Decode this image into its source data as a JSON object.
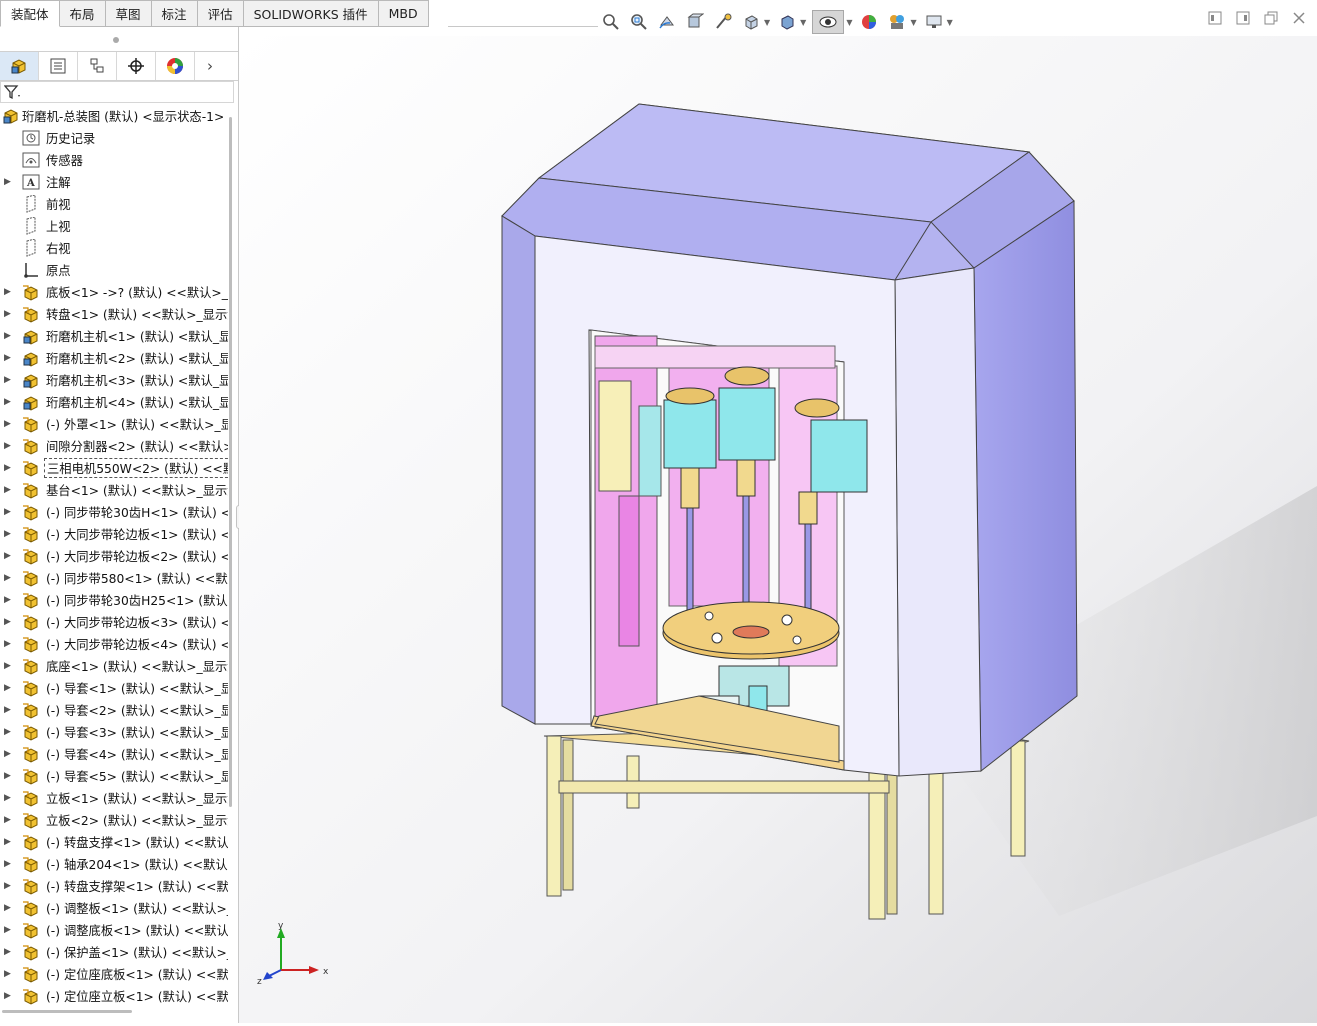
{
  "tabs": [
    "装配体",
    "布局",
    "草图",
    "标注",
    "评估",
    "SOLIDWORKS 插件",
    "MBD"
  ],
  "view_toolbar": {
    "icons": [
      "zoom-to-fit-icon",
      "zoom-area-icon",
      "previous-view-icon",
      "section-view-icon",
      "dynamic-annotation-icon",
      "view-orientation-icon",
      "display-style-icon",
      "hide-show-icon",
      "edit-appearance-icon",
      "apply-scene-icon",
      "view-settings-icon"
    ]
  },
  "feature_tree": {
    "root": "珩磨机-总装图 (默认) <显示状态-1>",
    "items": [
      {
        "label": "历史记录",
        "icon": "history-icon",
        "arrow": false
      },
      {
        "label": "传感器",
        "icon": "sensor-icon",
        "arrow": false
      },
      {
        "label": "注解",
        "icon": "annotation-icon",
        "arrow": true
      },
      {
        "label": "前视",
        "icon": "plane-icon",
        "arrow": false
      },
      {
        "label": "上视",
        "icon": "plane-icon",
        "arrow": false
      },
      {
        "label": "右视",
        "icon": "plane-icon",
        "arrow": false
      },
      {
        "label": "原点",
        "icon": "origin-icon",
        "arrow": false
      },
      {
        "label": "底板<1> ->? (默认) <<默认>_显",
        "icon": "part-icon",
        "arrow": true
      },
      {
        "label": "转盘<1> (默认) <<默认>_显示划",
        "icon": "part-icon",
        "arrow": true
      },
      {
        "label": "珩磨机主机<1> (默认) <默认_显",
        "icon": "assembly-icon",
        "arrow": true
      },
      {
        "label": "珩磨机主机<2> (默认) <默认_显",
        "icon": "assembly-icon",
        "arrow": true
      },
      {
        "label": "珩磨机主机<3> (默认) <默认_显",
        "icon": "assembly-icon",
        "arrow": true
      },
      {
        "label": "珩磨机主机<4> (默认) <默认_显",
        "icon": "assembly-icon",
        "arrow": true
      },
      {
        "label": "(-) 外罩<1> (默认) <<默认>_显",
        "icon": "part-icon",
        "arrow": true
      },
      {
        "label": "间隙分割器<2> (默认) <<默认>",
        "icon": "part-icon",
        "arrow": true
      },
      {
        "label": "三相电机550W<2> (默认) <<默",
        "icon": "part-icon",
        "arrow": true,
        "selected": true
      },
      {
        "label": "基台<1> (默认) <<默认>_显示划",
        "icon": "part-icon",
        "arrow": true
      },
      {
        "label": "(-) 同步带轮30齿H<1> (默认) <",
        "icon": "part-icon",
        "arrow": true
      },
      {
        "label": "(-) 大同步带轮边板<1> (默认) <",
        "icon": "part-icon",
        "arrow": true
      },
      {
        "label": "(-) 大同步带轮边板<2> (默认) <",
        "icon": "part-icon",
        "arrow": true
      },
      {
        "label": "(-) 同步带580<1> (默认) <<默认",
        "icon": "part-icon",
        "arrow": true
      },
      {
        "label": "(-) 同步带轮30齿H25<1> (默认)",
        "icon": "part-icon",
        "arrow": true
      },
      {
        "label": "(-) 大同步带轮边板<3> (默认) <",
        "icon": "part-icon",
        "arrow": true
      },
      {
        "label": "(-) 大同步带轮边板<4> (默认) <",
        "icon": "part-icon",
        "arrow": true
      },
      {
        "label": "底座<1> (默认) <<默认>_显示划",
        "icon": "part-icon",
        "arrow": true
      },
      {
        "label": "(-) 导套<1> (默认) <<默认>_显",
        "icon": "part-icon",
        "arrow": true
      },
      {
        "label": "(-) 导套<2> (默认) <<默认>_显",
        "icon": "part-icon",
        "arrow": true
      },
      {
        "label": "(-) 导套<3> (默认) <<默认>_显",
        "icon": "part-icon",
        "arrow": true
      },
      {
        "label": "(-) 导套<4> (默认) <<默认>_显",
        "icon": "part-icon",
        "arrow": true
      },
      {
        "label": "(-) 导套<5> (默认) <<默认>_显",
        "icon": "part-icon",
        "arrow": true
      },
      {
        "label": "立板<1> (默认) <<默认>_显示划",
        "icon": "part-icon",
        "arrow": true
      },
      {
        "label": "立板<2> (默认) <<默认>_显示划",
        "icon": "part-icon",
        "arrow": true
      },
      {
        "label": "(-) 转盘支撑<1> (默认) <<默认",
        "icon": "part-icon",
        "arrow": true
      },
      {
        "label": "(-) 轴承204<1> (默认) <<默认>",
        "icon": "part-icon",
        "arrow": true
      },
      {
        "label": "(-) 转盘支撑架<1> (默认) <<默",
        "icon": "part-icon",
        "arrow": true
      },
      {
        "label": "(-) 调整板<1> (默认) <<默认>_",
        "icon": "part-icon",
        "arrow": true
      },
      {
        "label": "(-) 调整底板<1> (默认) <<默认",
        "icon": "part-icon",
        "arrow": true
      },
      {
        "label": "(-) 保护盖<1> (默认) <<默认>_",
        "icon": "part-icon",
        "arrow": true
      },
      {
        "label": "(-) 定位座底板<1> (默认) <<默",
        "icon": "part-icon",
        "arrow": true
      },
      {
        "label": "(-) 定位座立板<1> (默认) <<默",
        "icon": "part-icon",
        "arrow": true
      }
    ]
  },
  "triad": {
    "x": "x",
    "y": "y",
    "z": "z"
  },
  "colors": {
    "housing": "#b4b3f0",
    "housing_front": "#f1f0fd",
    "base": "#f3dc9e",
    "frame": "#f5f0c0",
    "interior": "#f0a7ec",
    "motor": "#8fe7eb",
    "turntable": "#ecc46c"
  }
}
